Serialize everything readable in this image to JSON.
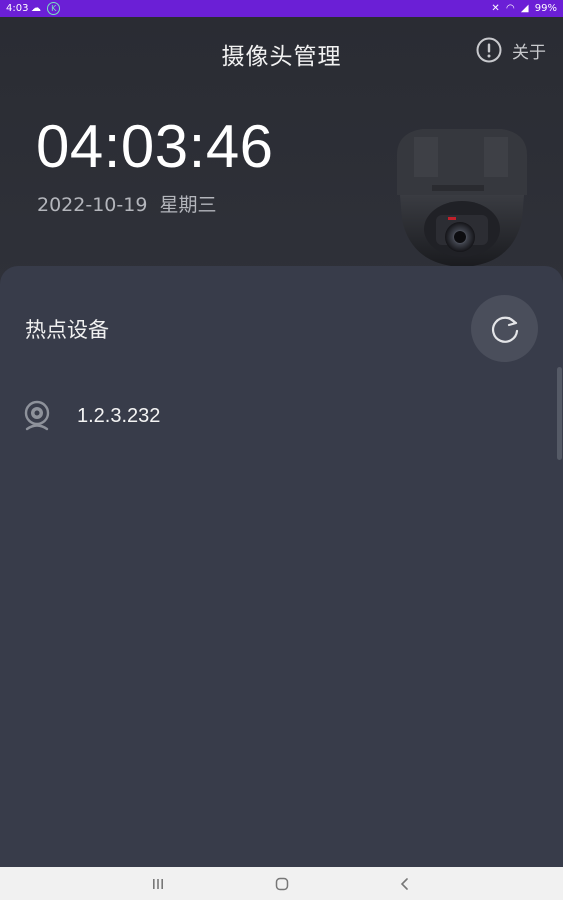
{
  "status_bar": {
    "time": "4:03",
    "left_icons": [
      "cloud-icon",
      "app-badge-icon"
    ],
    "app_badge_text": "K",
    "right_icons": [
      "mute-icon",
      "wifi-icon",
      "signal-icon"
    ],
    "battery": "99%",
    "background_color": "#6b1fd6"
  },
  "header": {
    "title": "摄像头管理",
    "about_label": "关于",
    "about_icon": "info-circle-icon"
  },
  "hero": {
    "time": "04:03:46",
    "date": "2022-10-19",
    "weekday": "星期三",
    "camera_image": "dome-camera-icon"
  },
  "panel": {
    "title": "热点设备",
    "refresh_icon": "refresh-icon",
    "devices": [
      {
        "label": "1.2.3.232",
        "icon": "webcam-icon"
      }
    ],
    "background_color": "#383c4a"
  },
  "nav": {
    "icons": [
      "recent-apps-icon",
      "home-icon",
      "back-icon"
    ]
  }
}
